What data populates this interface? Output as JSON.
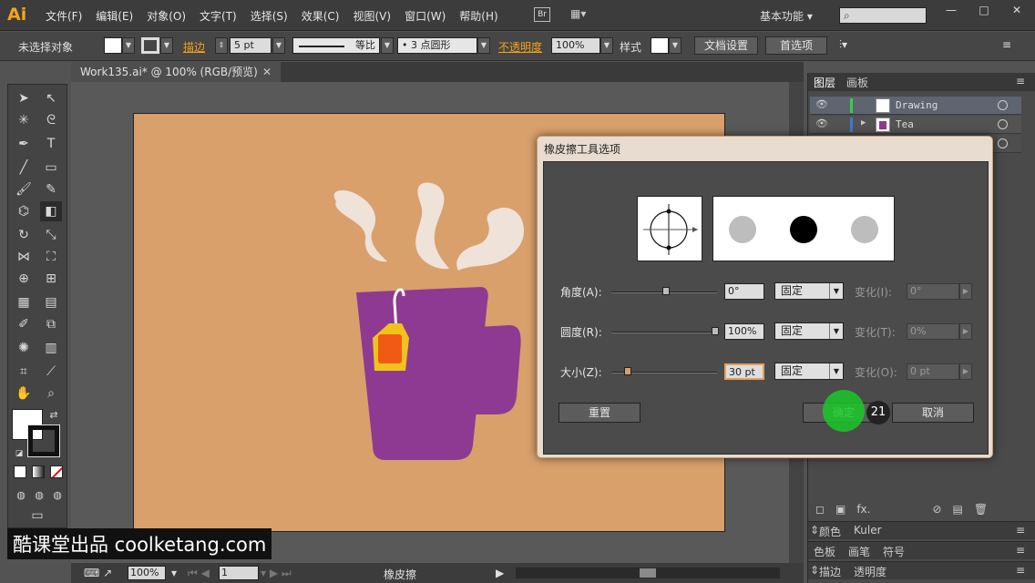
{
  "app": {
    "logo": "Ai",
    "menu": [
      "文件(F)",
      "编辑(E)",
      "对象(O)",
      "文字(T)",
      "选择(S)",
      "效果(C)",
      "视图(V)",
      "窗口(W)",
      "帮助(H)"
    ],
    "bridge": "Br",
    "workspace": "基本功能"
  },
  "control": {
    "no_selection": "未选择对象",
    "stroke_label": "描边",
    "stroke_value": "5 pt",
    "profile": "等比",
    "brush": "3 点圆形",
    "opacity_label": "不透明度",
    "opacity_value": "100%",
    "style_label": "样式",
    "doc_setup": "文档设置",
    "preferences": "首选项"
  },
  "document": {
    "tab": "Work135.ai* @ 100% (RGB/预览)",
    "zoom": "100%",
    "page": "1",
    "tool_name": "橡皮擦"
  },
  "layers": {
    "tabs": [
      "图层",
      "画板"
    ],
    "items": [
      {
        "name": "Drawing",
        "color": "#2fd24a"
      },
      {
        "name": "Tea",
        "color": "#3b7ad6"
      }
    ]
  },
  "subpanels": {
    "row1": [
      "颜色",
      "Kuler"
    ],
    "row2": [
      "色板",
      "画笔",
      "符号"
    ],
    "row3": [
      "描边",
      "透明度"
    ]
  },
  "dialog": {
    "title": "橡皮擦工具选项",
    "rows": [
      {
        "label": "角度(A):",
        "value": "0°",
        "mode": "固定",
        "var_label": "变化(I):",
        "var_value": "0°"
      },
      {
        "label": "圆度(R):",
        "value": "100%",
        "mode": "固定",
        "var_label": "变化(T):",
        "var_value": "0%"
      },
      {
        "label": "大小(Z):",
        "value": "30 pt",
        "mode": "固定",
        "var_label": "变化(O):",
        "var_value": "0 pt"
      }
    ],
    "reset": "重置",
    "ok": "确定",
    "cancel": "取消",
    "step": "21"
  },
  "watermark": "酷课堂出品 coolketang.com",
  "colors": {
    "artboard": "#d9a06c",
    "cup": "#8e3a92",
    "tag": "#f2c21a",
    "tag_inner": "#f05a14",
    "steam": "#efe2d8",
    "accent": "#f7a21b"
  }
}
